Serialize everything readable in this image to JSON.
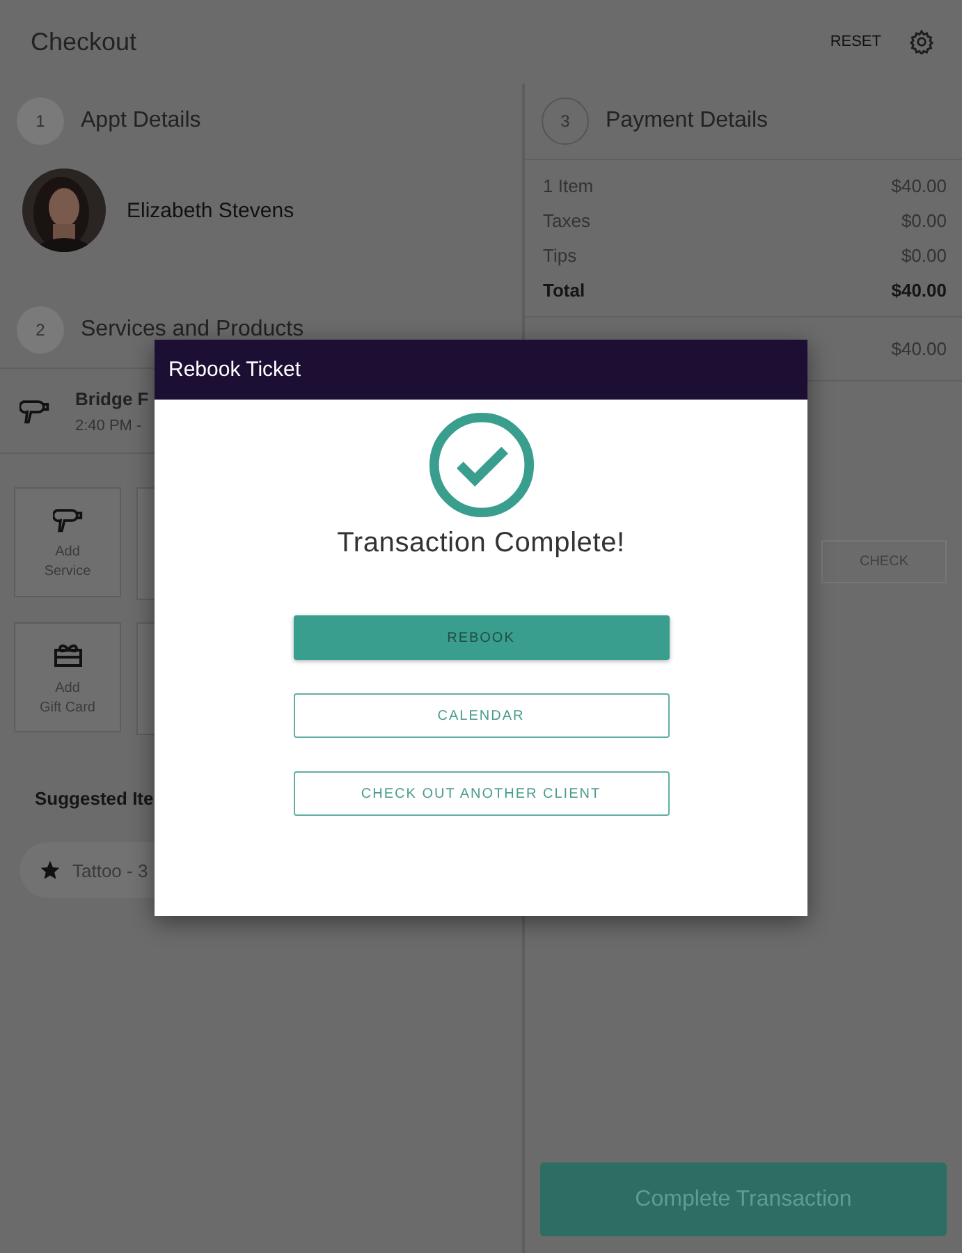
{
  "header": {
    "title": "Checkout",
    "reset": "RESET"
  },
  "appt": {
    "step": "1",
    "title": "Appt Details",
    "client": "Elizabeth Stevens"
  },
  "services": {
    "step": "2",
    "title": "Services and Products",
    "items": [
      {
        "name": "Bridge F",
        "time": "2:40 PM -"
      }
    ],
    "actions": [
      {
        "kind": "dryer",
        "lines": [
          "Add",
          "Service"
        ]
      },
      {
        "kind": "gift",
        "lines": [
          "Add",
          "Gift Card"
        ]
      }
    ]
  },
  "suggested": {
    "title": "Suggested Ite",
    "chips": [
      {
        "label": "Tattoo - 3"
      }
    ]
  },
  "payment": {
    "step": "3",
    "title": "Payment Details",
    "lines": [
      {
        "kind": "line",
        "label": "1 Item",
        "amount": "$40.00"
      },
      {
        "kind": "line",
        "label": "Taxes",
        "amount": "$0.00"
      },
      {
        "kind": "line",
        "label": "Tips",
        "amount": "$0.00"
      },
      {
        "kind": "total",
        "label": "Total",
        "amount": "$40.00"
      }
    ],
    "tenders": [
      {
        "amount": "$40.00"
      }
    ],
    "check_button": {
      "label": "CHECK",
      "disabled": true
    },
    "complete_button": "Complete Transaction"
  },
  "modal": {
    "title": "Rebook Ticket",
    "message": "Transaction Complete!",
    "buttons": [
      {
        "kind": "primary",
        "label": "REBOOK"
      },
      {
        "kind": "outline",
        "label": "CALENDAR"
      },
      {
        "kind": "outline",
        "label": "CHECK OUT ANOTHER CLIENT"
      }
    ]
  }
}
